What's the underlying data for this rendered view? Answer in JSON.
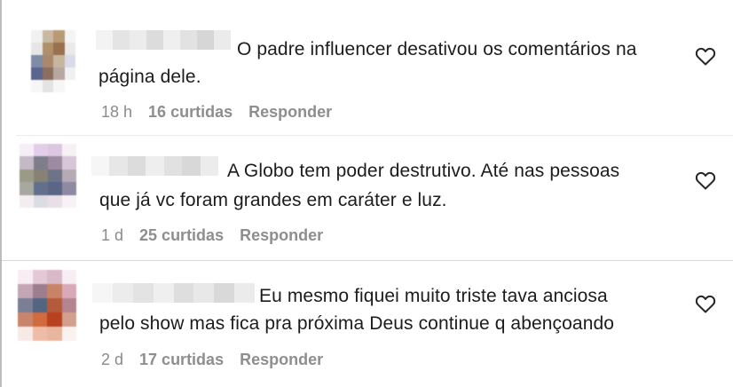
{
  "comments": [
    {
      "text_line1": "O padre influencer desativou os comentários na",
      "text_line2": "página dele.",
      "time": "18 h",
      "likes": "16 curtidas",
      "reply_label": "Responder",
      "like_icon": "heart-outline-icon"
    },
    {
      "text_line1": "A Globo tem poder destrutivo. Até nas pessoas",
      "text_line2": "que já vc foram grandes em caráter e luz.",
      "time": "1 d",
      "likes": "25 curtidas",
      "reply_label": "Responder",
      "like_icon": "heart-outline-icon"
    },
    {
      "text_line1": "Eu mesmo fiquei muito triste tava anciosa",
      "text_line2": "pelo show mas fica pra próxima Deus continue q abençoando",
      "time": "2 d",
      "likes": "17 curtidas",
      "reply_label": "Responder",
      "like_icon": "heart-outline-icon"
    }
  ],
  "colors": {
    "text": "#1c1c1c",
    "meta": "#8e8e8e",
    "divider": "#d8d8d8"
  }
}
